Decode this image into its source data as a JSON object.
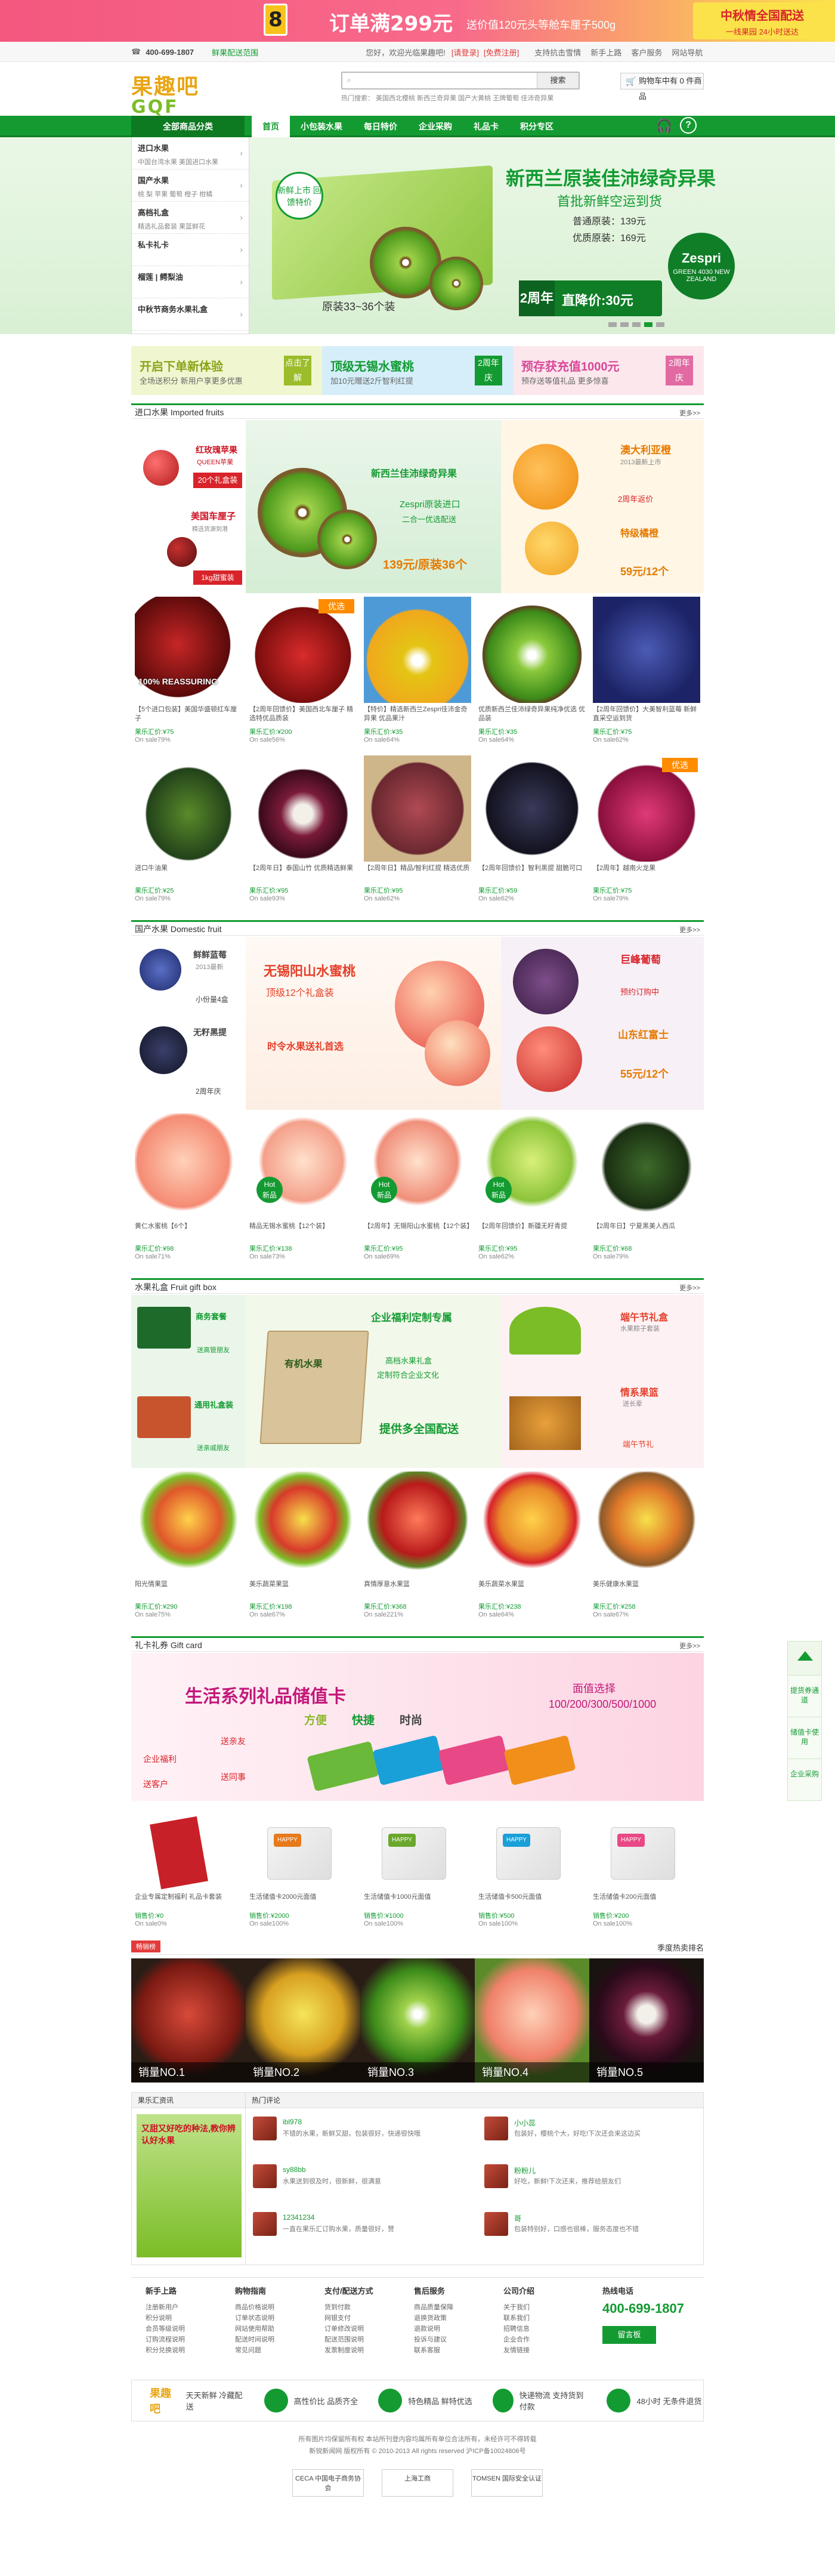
{
  "top_banner": {
    "badge": "8",
    "main": "订单满299元",
    "sub": "送价值120元头等舱车厘子500g",
    "right_title": "中秋情全国配送",
    "right_sub": "一线果园 24小时送达"
  },
  "toolbar": {
    "phone": "400-699-1807",
    "links": [
      "鲜果配送范围",
      "您好，欢迎光临果趣吧!",
      "[请登录]",
      "[免费注册]",
      "支持抗击雪情",
      "新手上路",
      "客户服务",
      "网站导航"
    ]
  },
  "header": {
    "logo_top": "果趣吧",
    "logo_bottom": "GQF",
    "search_placeholder": "",
    "search_btn": "搜索",
    "hotwords": "热门搜索：  美国西北樱桃  新西兰奇异果  国产大黄桃  王牌葡萄  佳沛奇异果",
    "cart": "购物车中有 0 件商品"
  },
  "nav": {
    "all": "全部商品分类",
    "items": [
      "首页",
      "小包装水果",
      "每日特价",
      "企业采购",
      "礼品卡",
      "积分专区"
    ]
  },
  "categories": [
    {
      "title": "进口水果",
      "sub": "中国台湾水果  美国进口水果"
    },
    {
      "title": "国产水果",
      "sub": "桃 梨 苹果  葡萄 橙子 柑橘"
    },
    {
      "title": "高档礼盒",
      "sub": "精选礼品套装  果篮鲜花"
    },
    {
      "title": "私卡礼卡",
      "sub": ""
    },
    {
      "title": "榴莲 | 鳄梨油",
      "sub": ""
    },
    {
      "title": "中秋节商务水果礼盒",
      "sub": ""
    }
  ],
  "hero": {
    "tag": "新鲜上市 回馈特价",
    "title": "新西兰原装佳沛绿奇异果",
    "subtitle": "首批新鲜空运到货",
    "price1": "普通原装：139元",
    "price2": "优质原装：169元",
    "pack": "原装33~36个装",
    "years": "2周年",
    "discount": "直降价:30元",
    "brand": "Zespri",
    "brand_sub": "GREEN 4030 NEW ZEALAND"
  },
  "promos": [
    {
      "title": "开启下单新体验",
      "sub": "全场送积分 新用户享更多优惠",
      "tag": "点击了解"
    },
    {
      "title": "顶级无锡水蜜桃",
      "sub": "加10元赠送2斤智利红提",
      "tag": "2周年庆"
    },
    {
      "title": "预存获充值1000元",
      "sub": "预存送等值礼品 更多惊喜",
      "tag": "2周年庆"
    }
  ],
  "sec1": {
    "title": "进口水果 Imported fruits",
    "more": "更多>>",
    "big_left": [
      "红玫瑰苹果",
      "QUEEN苹果",
      "20个礼盒装",
      "美国车厘子",
      "精选货源到港",
      "1kg甜蜜装"
    ],
    "big_mid": [
      "新西兰佳沛绿奇异果",
      "Zespri原装进口",
      "二合一优选配送",
      "139元/原装36个"
    ],
    "big_right": [
      "澳大利亚橙",
      "2013最新上市",
      "2周年返价",
      "特级橘橙",
      "59元/12个"
    ],
    "row1": [
      {
        "name": "【5个进口包装】美国华盛顿红车厘子",
        "price": "果乐汇价:¥75",
        "sale": "On sale79%",
        "ribbon": "",
        "extra": "100% REASSURING"
      },
      {
        "name": "【2周年回馈价】美国西北车厘子 精选特优品质装",
        "price": "果乐汇价:¥200",
        "sale": "On sale56%",
        "ribbon": "优选",
        "extra": ""
      },
      {
        "name": "【特价】精选新西兰Zespri佳沛金奇异果 优品果汁",
        "price": "果乐汇价:¥35",
        "sale": "On sale64%",
        "ribbon": "",
        "extra": ""
      },
      {
        "name": "优质新西兰佳沛绿奇异果纯净优选 优品装",
        "price": "果乐汇价:¥35",
        "sale": "On sale64%",
        "ribbon": "",
        "extra": ""
      },
      {
        "name": "【2周年回馈价】大美智利蓝莓 新鲜直采空运到货",
        "price": "果乐汇价:¥75",
        "sale": "On sale62%",
        "ribbon": "",
        "extra": ""
      }
    ],
    "row2": [
      {
        "name": "进口牛油果",
        "price": "果乐汇价:¥25",
        "sale": "On sale79%",
        "ribbon": ""
      },
      {
        "name": "【2周年日】泰国山竹 优质精选鲜果",
        "price": "果乐汇价:¥95",
        "sale": "On sale93%",
        "ribbon": ""
      },
      {
        "name": "【2周年日】精品/智利红提 精选优质",
        "price": "果乐汇价:¥95",
        "sale": "On sale62%",
        "ribbon": ""
      },
      {
        "name": "【2周年回馈价】智利黑提 甜脆可口",
        "price": "果乐汇价:¥59",
        "sale": "On sale62%",
        "ribbon": ""
      },
      {
        "name": "【2周年】越南火龙果",
        "price": "果乐汇价:¥75",
        "sale": "On sale79%",
        "ribbon": "优选"
      }
    ]
  },
  "sec2": {
    "title": "国产水果 Domestic fruit",
    "more": "更多>>",
    "big_left": [
      "鲜鲜蓝莓",
      "2013最新",
      "小份量4盒",
      "无籽黑提",
      "2周年庆"
    ],
    "big_mid": [
      "无锡阳山水蜜桃",
      "顶级12个礼盒装",
      "时令水果送礼首选"
    ],
    "big_right": [
      "巨峰葡萄",
      "预约订购中",
      "山东红富士",
      "55元/12个"
    ],
    "row": [
      {
        "name": "黄仁水蜜桃【6个】",
        "price": "果乐汇价:¥98",
        "sale": "On sale71%",
        "hot": false
      },
      {
        "name": "精品无锡水蜜桃【12个装】",
        "price": "果乐汇价:¥138",
        "sale": "On sale73%",
        "hot": true
      },
      {
        "name": "【2周年】无锡阳山水蜜桃【12个装】",
        "price": "果乐汇价:¥95",
        "sale": "On sale69%",
        "hot": true
      },
      {
        "name": "【2周年回馈价】新疆无籽青提",
        "price": "果乐汇价:¥95",
        "sale": "On sale62%",
        "hot": true
      },
      {
        "name": "【2周年日】宁夏黑美人西瓜",
        "price": "果乐汇价:¥68",
        "sale": "On sale79%",
        "hot": false
      }
    ]
  },
  "sec3": {
    "title": "水果礼盒 Fruit gift box",
    "more": "更多>>",
    "big_left": [
      "商务套餐",
      "送高管朋友",
      "通用礼盒装",
      "送亲戚朋友"
    ],
    "big_mid": [
      "企业福利定制专属",
      "高档水果礼盒",
      "定制符合企业文化",
      "提供多全国配送",
      "有机水果"
    ],
    "big_right": [
      "端午节礼盒",
      "水果粽子套装",
      "情系果篮",
      "送长辈",
      "端午节礼"
    ],
    "row": [
      {
        "name": "阳光情果篮",
        "price": "果乐汇价:¥290",
        "sale": "On sale75%"
      },
      {
        "name": "美乐蔬菜果篮",
        "price": "果乐汇价:¥198",
        "sale": "On sale67%"
      },
      {
        "name": "真情厚意水果篮",
        "price": "果乐汇价:¥368",
        "sale": "On sale221%"
      },
      {
        "name": "美乐蔬菜水果篮",
        "price": "果乐汇价:¥238",
        "sale": "On sale64%"
      },
      {
        "name": "美乐健康水果篮",
        "price": "果乐汇价:¥258",
        "sale": "On sale67%"
      }
    ]
  },
  "sec4": {
    "title": "礼卡礼券 Gift card",
    "more": "更多>>",
    "banner_title": "生活系列礼品储值卡",
    "banner_words": [
      "方便",
      "快捷",
      "时尚"
    ],
    "banner_right": "面值选择",
    "banner_right_vals": "100/200/300/500/1000",
    "banner_left": [
      "送亲友",
      "企业福利",
      "送同事",
      "送客户"
    ],
    "cards": [
      {
        "name": "企业专属定制福利 礼品卡套装",
        "price": "销售价:¥0",
        "sale": "On sale0%",
        "color": "#c82028"
      },
      {
        "name": "生活储值卡2000元面值",
        "price": "销售价:¥2000",
        "sale": "On sale100%",
        "color": "#e77a1a"
      },
      {
        "name": "生活储值卡1000元面值",
        "price": "销售价:¥1000",
        "sale": "On sale100%",
        "color": "#6aa82d"
      },
      {
        "name": "生活储值卡500元面值",
        "price": "销售价:¥500",
        "sale": "On sale100%",
        "color": "#1aa0d8"
      },
      {
        "name": "生活储值卡200元面值",
        "price": "销售价:¥200",
        "sale": "On sale100%",
        "color": "#e84886"
      }
    ]
  },
  "hot": {
    "tag": "畅销榜",
    "right": "季度热卖排名",
    "items": [
      "销量NO.1",
      "销量NO.2",
      "销量NO.3",
      "销量NO.4",
      "销量NO.5"
    ]
  },
  "blogs": {
    "left_title": "果乐汇资讯",
    "left_text": "又甜又好吃的种法,教你辨认好水果",
    "right_title": "热门评论",
    "comments": [
      {
        "user": "ibl978",
        "text": "不错的水果，新鲜又甜，包装很好，快递很快哦"
      },
      {
        "user": "小小蕊",
        "text": "包装好，樱桃个大，好吃!下次还会来这边买"
      },
      {
        "user": "sy88bb",
        "text": "水果送到很及时，很新鲜，很满意"
      },
      {
        "user": "粉粉儿",
        "text": "好吃，新鲜!下次还来，推荐给朋友们"
      },
      {
        "user": "12341234",
        "text": "一直在果乐汇订购水果，质量很好，赞"
      },
      {
        "user": "哥",
        "text": "包装特别好，口感也很棒，服务态度也不错"
      }
    ]
  },
  "footer": {
    "cols": [
      {
        "title": "新手上路",
        "items": [
          "注册新用户",
          "积分说明",
          "会员等级说明",
          "订购流程说明",
          "积分兑换说明"
        ]
      },
      {
        "title": "购物指南",
        "items": [
          "商品价格说明",
          "订单状态说明",
          "网站使用帮助",
          "配送时间说明",
          "常见问题"
        ]
      },
      {
        "title": "支付/配送方式",
        "items": [
          "货到付款",
          "网银支付",
          "订单修改说明",
          "配送范围说明",
          "发票制度说明"
        ]
      },
      {
        "title": "售后服务",
        "items": [
          "商品质量保障",
          "退换货政策",
          "退款说明",
          "投诉与建议",
          "联系客服"
        ]
      },
      {
        "title": "公司介绍",
        "items": [
          "关于我们",
          "联系我们",
          "招聘信息",
          "企业合作",
          "友情链接"
        ]
      }
    ],
    "hotline_title": "热线电话",
    "hotline": "400-699-1807",
    "msg_btn": "留言板",
    "guarantee": [
      "天天新鲜 冷藏配送",
      "高性价比 品质齐全",
      "特色精品 鲜特优选",
      "快递物流 支持货到付款",
      "48小时 无条件退货"
    ],
    "copyright1": "所有图片均保留所有权 本站所刊登内容均属所有单位合法所有，未经许可不得转载",
    "copyright2": "新锐新闻网 版权所有 © 2010-2013 All rights reserved 沪ICP备10024806号",
    "certs": [
      "CECA 中国电子商务协会",
      "上海工商",
      "TOMSEN 国际安全认证"
    ]
  },
  "side": [
    "提货券通道",
    "储值卡使用",
    "企业采购"
  ]
}
